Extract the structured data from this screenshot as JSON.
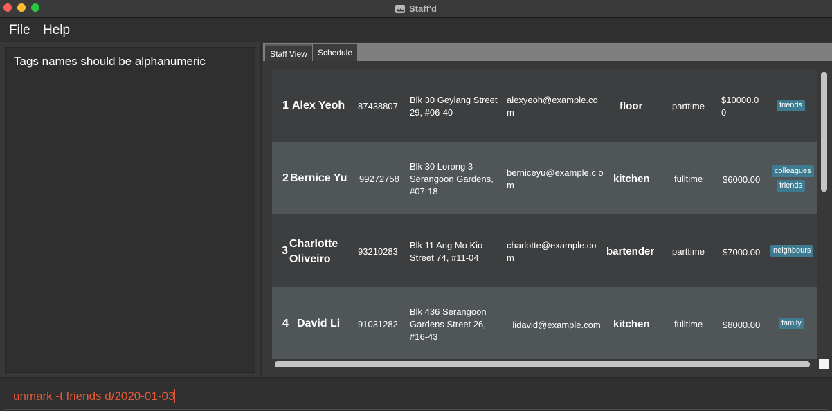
{
  "window": {
    "title": "Staff'd"
  },
  "menu": {
    "file": "File",
    "help": "Help"
  },
  "result": {
    "message": "Tags names should be alphanumeric"
  },
  "tabs": [
    {
      "label": "Staff View"
    },
    {
      "label": "Schedule"
    }
  ],
  "staff": [
    {
      "index": "1",
      "name": "Alex Yeoh",
      "phone": "87438807",
      "address": "Blk 30 Geylang Street 29, #06-40",
      "email": "alexyeoh@example.co m",
      "role": "floor",
      "employment": "parttime",
      "salary": "$10000.0 0",
      "tags": [
        "friends"
      ]
    },
    {
      "index": "2",
      "name": "Bernice Yu",
      "phone": "99272758",
      "address": "Blk 30 Lorong 3 Serangoon Gardens, #07-18",
      "email": "berniceyu@example.c om",
      "role": "kitchen",
      "employment": "fulltime",
      "salary": "$6000.00",
      "tags": [
        "colleagues",
        "friends"
      ]
    },
    {
      "index": "3",
      "name": "Charlotte Oliveiro",
      "phone": "93210283",
      "address": "Blk 11 Ang Mo Kio Street 74, #11-04",
      "email": "charlotte@example.co m",
      "role": "bartender",
      "employment": "parttime",
      "salary": "$7000.00",
      "tags": [
        "neighbours"
      ]
    },
    {
      "index": "4",
      "name": "David Li",
      "phone": "91031282",
      "address": "Blk 436 Serangoon Gardens Street 26, #16-43",
      "email": "lidavid@example.com",
      "role": "kitchen",
      "employment": "fulltime",
      "salary": "$8000.00",
      "tags": [
        "family"
      ]
    }
  ],
  "command": {
    "value": "unmark -t friends d/2020-01-03"
  }
}
